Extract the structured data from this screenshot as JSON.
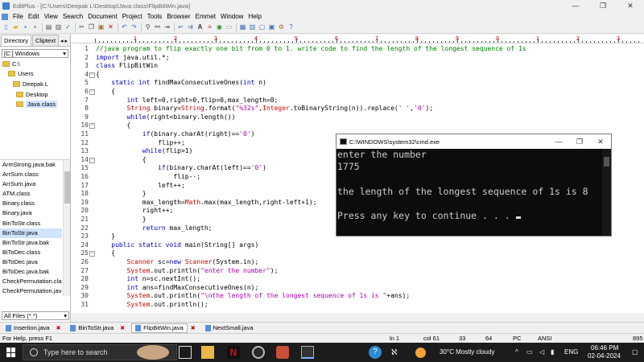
{
  "window": {
    "title": "EditPlus - [C:\\Users\\Deepak L\\Desktop\\Java class\\FlipBitWin.java]",
    "min": "—",
    "max": "❐",
    "close": "✕"
  },
  "menu": [
    "File",
    "Edit",
    "View",
    "Search",
    "Document",
    "Project",
    "Tools",
    "Browser",
    "Emmet",
    "Window",
    "Help"
  ],
  "left_panel": {
    "tabs": [
      "Directory",
      "Cliptext"
    ],
    "drive": "[C:] Windows",
    "tree": [
      "C:\\",
      "Users",
      "Deepak L",
      "Desktop",
      "Java class"
    ],
    "files": [
      "ArmStrong.java.bak",
      "ArrSum.class",
      "ArrSum.java",
      "ATM.class",
      "Binary.class",
      "Binary.java",
      "BinToStr.class",
      "BinToStr.java",
      "BinToStr.java.bak",
      "BiToDec.class",
      "BiToDec.java",
      "BiToDec.java.bak",
      "CheckPermutation.clas",
      "CheckPermutation.java"
    ],
    "filter": "All Files (*.*)"
  },
  "ruler": [
    "1",
    "2",
    "3",
    "4",
    "5",
    "6",
    "7",
    "8",
    "9",
    "0",
    "1",
    "2",
    "3"
  ],
  "editor": {
    "line_numbers": [
      "1",
      "2",
      "3",
      "4",
      "5",
      "6",
      "7",
      "8",
      "9",
      "10",
      "11",
      "12",
      "13",
      "14",
      "15",
      "16",
      "17",
      "18",
      "19",
      "20",
      "21",
      "22",
      "23",
      "24",
      "25",
      "26",
      "27",
      "28",
      "29",
      "30",
      "31"
    ],
    "lines": [
      [
        {
          "t": "//java program to flip exactly one bit from 0 to 1. write code to find the length of the longest sequence of 1s",
          "c": "cmt"
        }
      ],
      [
        {
          "t": "import",
          "c": "kw"
        },
        {
          "t": " java.util.*;",
          "c": ""
        }
      ],
      [
        {
          "t": "class",
          "c": "kw"
        },
        {
          "t": " FlipBitWin",
          "c": ""
        }
      ],
      [
        {
          "t": "{",
          "c": ""
        }
      ],
      [
        {
          "t": "    ",
          "c": ""
        },
        {
          "t": "static int",
          "c": "kw"
        },
        {
          "t": " findMaxConsecutiveOnes(",
          "c": ""
        },
        {
          "t": "int",
          "c": "kw"
        },
        {
          "t": " n)",
          "c": ""
        }
      ],
      [
        {
          "t": "    {",
          "c": ""
        }
      ],
      [
        {
          "t": "        ",
          "c": ""
        },
        {
          "t": "int",
          "c": "kw"
        },
        {
          "t": " left=0,right=0,flip=0,max_length=0;",
          "c": ""
        }
      ],
      [
        {
          "t": "        ",
          "c": ""
        },
        {
          "t": "String",
          "c": "mth"
        },
        {
          "t": " binary=",
          "c": ""
        },
        {
          "t": "String",
          "c": "mth"
        },
        {
          "t": ".format(",
          "c": ""
        },
        {
          "t": "\"%32s\"",
          "c": "str"
        },
        {
          "t": ",",
          "c": ""
        },
        {
          "t": "Integer",
          "c": "mth"
        },
        {
          "t": ".toBinaryString(n)).replace(",
          "c": ""
        },
        {
          "t": "' '",
          "c": "str"
        },
        {
          "t": ",",
          "c": ""
        },
        {
          "t": "'0'",
          "c": "str"
        },
        {
          "t": ");",
          "c": ""
        }
      ],
      [
        {
          "t": "        ",
          "c": ""
        },
        {
          "t": "while",
          "c": "kw"
        },
        {
          "t": "(right<binary.length())",
          "c": ""
        }
      ],
      [
        {
          "t": "        {",
          "c": ""
        }
      ],
      [
        {
          "t": "            ",
          "c": ""
        },
        {
          "t": "if",
          "c": "kw"
        },
        {
          "t": "(binary.charAt(right)==",
          "c": ""
        },
        {
          "t": "'0'",
          "c": "str"
        },
        {
          "t": ")",
          "c": ""
        }
      ],
      [
        {
          "t": "                flip++;",
          "c": ""
        }
      ],
      [
        {
          "t": "            ",
          "c": ""
        },
        {
          "t": "while",
          "c": "kw"
        },
        {
          "t": "(flip>1)",
          "c": ""
        }
      ],
      [
        {
          "t": "            {",
          "c": ""
        }
      ],
      [
        {
          "t": "                ",
          "c": ""
        },
        {
          "t": "if",
          "c": "kw"
        },
        {
          "t": "(binary.charAt(left)==",
          "c": ""
        },
        {
          "t": "'0'",
          "c": "str"
        },
        {
          "t": ")",
          "c": ""
        }
      ],
      [
        {
          "t": "                    flip--;",
          "c": ""
        }
      ],
      [
        {
          "t": "                left++;",
          "c": ""
        }
      ],
      [
        {
          "t": "            }",
          "c": ""
        }
      ],
      [
        {
          "t": "            max_length=",
          "c": ""
        },
        {
          "t": "Math",
          "c": "mth"
        },
        {
          "t": ".max(max_length,right-left+1);",
          "c": ""
        }
      ],
      [
        {
          "t": "            right++;",
          "c": ""
        }
      ],
      [
        {
          "t": "            }",
          "c": ""
        }
      ],
      [
        {
          "t": "            ",
          "c": ""
        },
        {
          "t": "return",
          "c": "kw"
        },
        {
          "t": " max_length;",
          "c": ""
        }
      ],
      [
        {
          "t": "    }",
          "c": ""
        }
      ],
      [
        {
          "t": "    ",
          "c": ""
        },
        {
          "t": "public static void",
          "c": "kw"
        },
        {
          "t": " main(String[] args)",
          "c": ""
        }
      ],
      [
        {
          "t": "    {",
          "c": ""
        }
      ],
      [
        {
          "t": "        ",
          "c": ""
        },
        {
          "t": "Scanner",
          "c": "mth"
        },
        {
          "t": " sc=",
          "c": ""
        },
        {
          "t": "new",
          "c": "kw"
        },
        {
          "t": " ",
          "c": ""
        },
        {
          "t": "Scanner",
          "c": "mth"
        },
        {
          "t": "(System.in);",
          "c": ""
        }
      ],
      [
        {
          "t": "        ",
          "c": ""
        },
        {
          "t": "System",
          "c": "mth"
        },
        {
          "t": ".out.println(",
          "c": ""
        },
        {
          "t": "\"enter the number\"",
          "c": "str"
        },
        {
          "t": ");",
          "c": ""
        }
      ],
      [
        {
          "t": "        ",
          "c": ""
        },
        {
          "t": "int",
          "c": "kw"
        },
        {
          "t": " n=sc.nextInt();",
          "c": ""
        }
      ],
      [
        {
          "t": "        ",
          "c": ""
        },
        {
          "t": "int",
          "c": "kw"
        },
        {
          "t": " ans=findMaxConsecutiveOnes(n);",
          "c": ""
        }
      ],
      [
        {
          "t": "        ",
          "c": ""
        },
        {
          "t": "System",
          "c": "mth"
        },
        {
          "t": ".out.println(",
          "c": ""
        },
        {
          "t": "\"\\nthe length of the longest sequence of 1s is \"",
          "c": "str"
        },
        {
          "t": "+ans);",
          "c": ""
        }
      ],
      [
        {
          "t": "        ",
          "c": ""
        },
        {
          "t": "System",
          "c": "mth"
        },
        {
          "t": ".out.println();",
          "c": ""
        }
      ]
    ]
  },
  "cmd": {
    "title": "C:\\WINDOWS\\system32\\cmd.exe",
    "lines": [
      "enter the number",
      "1775",
      "",
      "the length of the longest sequence of 1s is 8",
      "",
      "Press any key to continue . . . "
    ]
  },
  "doc_tabs": [
    "Insertion.java",
    "BinToStr.java",
    "FlipBitWin.java",
    "NextSmall.java"
  ],
  "status": {
    "help": "For Help, press F1",
    "ln": "ln 1",
    "col": "col 61",
    "n1": "33",
    "n2": "64",
    "mode": "PC",
    "enc": "ANSI",
    "size": "895"
  },
  "taskbar": {
    "search_placeholder": "Type here to search",
    "weather": "30°C  Mostly cloudy",
    "lang": "ENG",
    "time": "06:46 PM",
    "date": "02-04-2024"
  }
}
